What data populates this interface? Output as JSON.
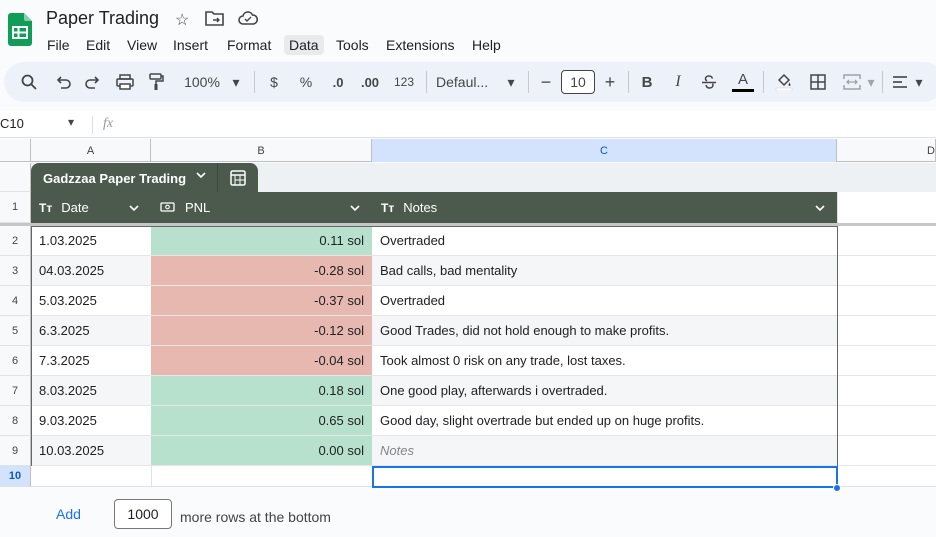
{
  "app": {
    "title": "Paper Trading"
  },
  "menu": [
    "File",
    "Edit",
    "View",
    "Insert",
    "Format",
    "Data",
    "Tools",
    "Extensions",
    "Help"
  ],
  "toolbar": {
    "zoom": "100%",
    "currency": "$",
    "percent": "%",
    "dec_decrease": ".0",
    "dec_increase": ".00",
    "number_format": "123",
    "font": "Defaul...",
    "font_size": "10",
    "bold": "B",
    "italic": "I",
    "text_color": "A"
  },
  "formula_bar": {
    "cell_ref": "C10",
    "fx": "fx"
  },
  "columns": [
    "A",
    "B",
    "C",
    "D"
  ],
  "table": {
    "name": "Gadzzaa Paper Trading",
    "headers": [
      {
        "icon": "Tт",
        "label": "Date"
      },
      {
        "icon": "▭",
        "label": "PNL"
      },
      {
        "icon": "Tт",
        "label": "Notes"
      }
    ],
    "rows": [
      {
        "num": "2",
        "date": "1.03.2025",
        "pnl": "0.11 sol",
        "notes": "Overtraded"
      },
      {
        "num": "3",
        "date": "04.03.2025",
        "pnl": "-0.28 sol",
        "notes": "Bad calls, bad mentality"
      },
      {
        "num": "4",
        "date": "5.03.2025",
        "pnl": "-0.37 sol",
        "notes": "Overtraded"
      },
      {
        "num": "5",
        "date": "6.3.2025",
        "pnl": "-0.12 sol",
        "notes": "Good Trades, did not hold enough to make profits."
      },
      {
        "num": "6",
        "date": "7.3.2025",
        "pnl": "-0.04 sol",
        "notes": "Took almost 0 risk on any trade, lost taxes."
      },
      {
        "num": "7",
        "date": "8.03.2025",
        "pnl": "0.18 sol",
        "notes": "One good play, afterwards i overtraded."
      },
      {
        "num": "8",
        "date": "9.03.2025",
        "pnl": "0.65 sol",
        "notes": "Good day, slight overtrade but ended up on huge profits."
      },
      {
        "num": "9",
        "date": "10.03.2025",
        "pnl": "0.00 sol",
        "notes": "Notes"
      }
    ]
  },
  "row_numbers": {
    "tab": "",
    "header": "1",
    "selected": "10"
  },
  "footer": {
    "add_label": "Add",
    "rows_value": "1000",
    "rows_text": "more rows at the bottom"
  },
  "colors": {
    "table_header": "#4c5a4d",
    "positive": "#b7e1cd",
    "negative": "#e6b8af",
    "selection": "#1a73e8"
  }
}
